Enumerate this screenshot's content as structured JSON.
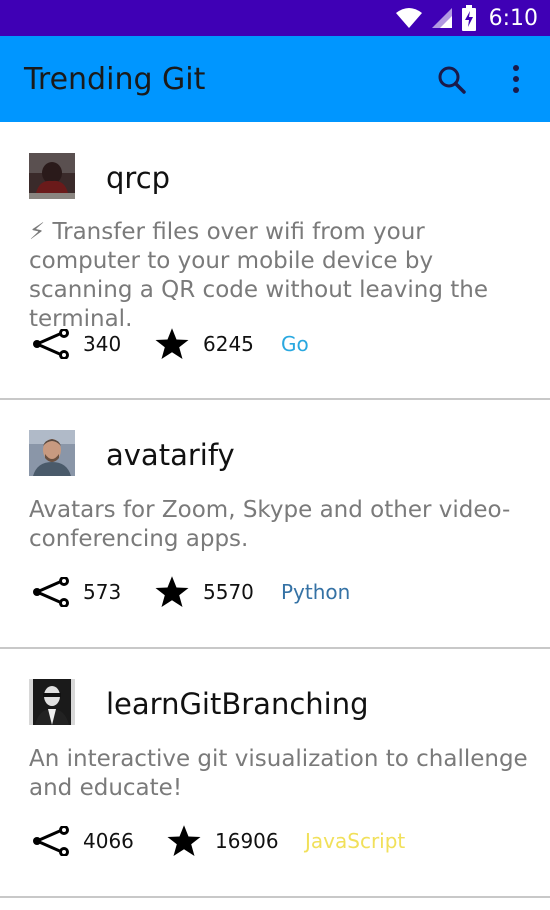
{
  "status_bar": {
    "time": "6:10",
    "icons": [
      "wifi-icon",
      "cell-signal-icon",
      "battery-charging-icon"
    ]
  },
  "app_bar": {
    "title": "Trending Git",
    "actions": [
      "search-icon",
      "more-vert-icon"
    ]
  },
  "repos": [
    {
      "name": "qrcp",
      "description": "⚡ Transfer files over wifi from your computer to your mobile device by scanning a QR code without leaving the terminal.",
      "forks": "340",
      "stars": "6245",
      "language": "Go",
      "language_color": "#29a8e0"
    },
    {
      "name": "avatarify",
      "description": "Avatars for Zoom, Skype and other video-conferencing apps.",
      "forks": "573",
      "stars": "5570",
      "language": "Python",
      "language_color": "#3572a5"
    },
    {
      "name": "learnGitBranching",
      "description": "An interactive git visualization to challenge and educate!",
      "forks": "4066",
      "stars": "16906",
      "language": "JavaScript",
      "language_color": "#f1e05a"
    }
  ]
}
